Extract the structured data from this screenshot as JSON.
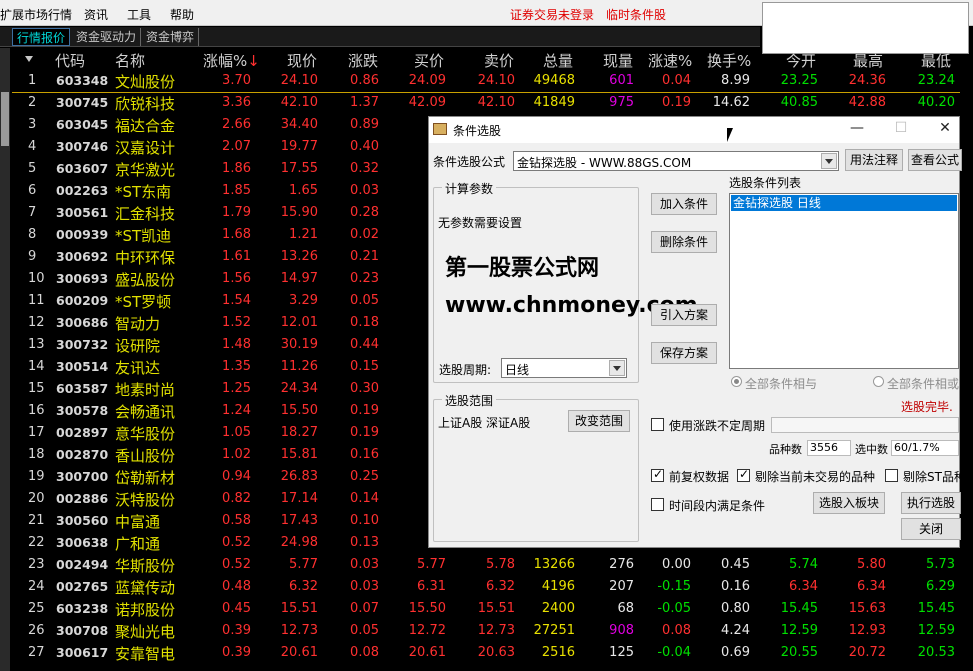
{
  "menu": {
    "items": [
      "扩展市场行情",
      "资讯",
      "工具",
      "帮助"
    ],
    "status_login": "证券交易未登录",
    "status_temp": "临时条件股"
  },
  "tabs": [
    "行情报价",
    "资金驱动力",
    "资金博弈"
  ],
  "table": {
    "headers": [
      "代码",
      "名称",
      "涨幅%",
      "现价",
      "涨跌",
      "买价",
      "卖价",
      "总量",
      "现量",
      "涨速%",
      "换手%",
      "今开",
      "最高",
      "最低"
    ],
    "rows": [
      [
        "1",
        "603348",
        "文灿股份",
        "3.70",
        "24.10",
        "0.86",
        "24.09",
        "24.10",
        "49468",
        "601",
        "0.04",
        "8.99",
        "23.25",
        "24.36",
        "23.24"
      ],
      [
        "2",
        "300745",
        "欣锐科技",
        "3.36",
        "42.10",
        "1.37",
        "42.09",
        "42.10",
        "41849",
        "975",
        "0.19",
        "14.62",
        "40.85",
        "42.88",
        "40.20"
      ],
      [
        "3",
        "603045",
        "福达合金",
        "2.66",
        "34.40",
        "0.89",
        "34",
        "",
        "",
        "",
        "",
        "",
        "",
        "",
        ""
      ],
      [
        "4",
        "300746",
        "汉嘉设计",
        "2.07",
        "19.77",
        "0.40",
        "19",
        "",
        "",
        "",
        "",
        "",
        "",
        "",
        ""
      ],
      [
        "5",
        "603607",
        "京华激光",
        "1.86",
        "17.55",
        "0.32",
        "17",
        "",
        "",
        "",
        "",
        "",
        "",
        "",
        ""
      ],
      [
        "6",
        "002263",
        "*ST东南",
        "1.85",
        "1.65",
        "0.03",
        "1",
        "",
        "",
        "",
        "",
        "",
        "",
        "",
        ""
      ],
      [
        "7",
        "300561",
        "汇金科技",
        "1.79",
        "15.90",
        "0.28",
        "15",
        "",
        "",
        "",
        "",
        "",
        "",
        "",
        ""
      ],
      [
        "8",
        "000939",
        "*ST凯迪",
        "1.68",
        "1.21",
        "0.02",
        "1",
        "",
        "",
        "",
        "",
        "",
        "",
        "",
        ""
      ],
      [
        "9",
        "300692",
        "中环环保",
        "1.61",
        "13.26",
        "0.21",
        "13",
        "",
        "",
        "",
        "",
        "",
        "",
        "",
        ""
      ],
      [
        "10",
        "300693",
        "盛弘股份",
        "1.56",
        "14.97",
        "0.23",
        "14",
        "",
        "",
        "",
        "",
        "",
        "",
        "",
        ""
      ],
      [
        "11",
        "600209",
        "*ST罗顿",
        "1.54",
        "3.29",
        "0.05",
        "3",
        "",
        "",
        "",
        "",
        "",
        "",
        "",
        ""
      ],
      [
        "12",
        "300686",
        "智动力",
        "1.52",
        "12.01",
        "0.18",
        "12",
        "",
        "",
        "",
        "",
        "",
        "",
        "",
        ""
      ],
      [
        "13",
        "300732",
        "设研院",
        "1.48",
        "30.19",
        "0.44",
        "30",
        "",
        "",
        "",
        "",
        "",
        "",
        "",
        ""
      ],
      [
        "14",
        "300514",
        "友讯达",
        "1.35",
        "11.26",
        "0.15",
        "11",
        "",
        "",
        "",
        "",
        "",
        "",
        "",
        ""
      ],
      [
        "15",
        "603587",
        "地素时尚",
        "1.25",
        "24.34",
        "0.30",
        "24",
        "",
        "",
        "",
        "",
        "",
        "",
        "",
        ""
      ],
      [
        "16",
        "300578",
        "会畅通讯",
        "1.24",
        "15.50",
        "0.19",
        "15",
        "",
        "",
        "",
        "",
        "",
        "",
        "",
        ""
      ],
      [
        "17",
        "002897",
        "意华股份",
        "1.05",
        "18.27",
        "0.19",
        "18",
        "",
        "",
        "",
        "",
        "",
        "",
        "",
        ""
      ],
      [
        "18",
        "002870",
        "香山股份",
        "1.02",
        "15.81",
        "0.16",
        "15",
        "",
        "",
        "",
        "",
        "",
        "",
        "",
        ""
      ],
      [
        "19",
        "300700",
        "岱勒新材",
        "0.94",
        "26.83",
        "0.25",
        "26",
        "",
        "",
        "",
        "",
        "",
        "",
        "",
        ""
      ],
      [
        "20",
        "002886",
        "沃特股份",
        "0.82",
        "17.14",
        "0.14",
        "17",
        "",
        "",
        "",
        "",
        "",
        "",
        "",
        ""
      ],
      [
        "21",
        "300560",
        "中富通",
        "0.58",
        "17.43",
        "0.10",
        "17",
        "",
        "",
        "",
        "",
        "",
        "",
        "",
        ""
      ],
      [
        "22",
        "300638",
        "广和通",
        "0.52",
        "24.98",
        "0.13",
        "24",
        "",
        "",
        "",
        "",
        "",
        "",
        "",
        ""
      ],
      [
        "23",
        "002494",
        "华斯股份",
        "0.52",
        "5.77",
        "0.03",
        "5.77",
        "5.78",
        "13266",
        "276",
        "0.00",
        "0.45",
        "5.74",
        "5.80",
        "5.73"
      ],
      [
        "24",
        "002765",
        "蓝黛传动",
        "0.48",
        "6.32",
        "0.03",
        "6.31",
        "6.32",
        "4196",
        "207",
        "-0.15",
        "0.16",
        "6.34",
        "6.34",
        "6.29"
      ],
      [
        "25",
        "603238",
        "诺邦股份",
        "0.45",
        "15.51",
        "0.07",
        "15.50",
        "15.51",
        "2400",
        "68",
        "-0.05",
        "0.80",
        "15.45",
        "15.63",
        "15.45"
      ],
      [
        "26",
        "300708",
        "聚灿光电",
        "0.39",
        "12.73",
        "0.05",
        "12.72",
        "12.73",
        "27251",
        "908",
        "0.08",
        "4.24",
        "12.59",
        "12.93",
        "12.59"
      ],
      [
        "27",
        "300617",
        "安靠智电",
        "0.39",
        "20.61",
        "0.08",
        "20.61",
        "20.63",
        "2516",
        "125",
        "-0.04",
        "0.69",
        "20.55",
        "20.72",
        "20.53"
      ]
    ]
  },
  "dialog": {
    "title": "条件选股",
    "formula_label": "条件选股公式",
    "formula_value": "金钻探选股   - WWW.88GS.COM",
    "usage_btn": "用法注释",
    "view_btn": "查看公式",
    "calc_group": "计算参数",
    "no_params": "无参数需要设置",
    "watermark_name": "第一股票公式网",
    "watermark_url": "www.chnmoney.com",
    "add_btn": "加入条件",
    "delete_btn": "删除条件",
    "import_btn": "引入方案",
    "save_btn": "保存方案",
    "list_label": "选股条件列表",
    "list_item": "金钻探选股   日线",
    "period_label": "选股周期:",
    "period_value": "日线",
    "all_and": "全部条件相与",
    "all_or": "全部条件相或",
    "done": "选股完毕.",
    "range_group": "选股范围",
    "range_value": "上证A股  深证A股",
    "change_range_btn": "改变范围",
    "use_uncertain": "使用涨跌不定周期",
    "count_label": "品种数",
    "count_value": "3556",
    "selected_label": "选中数",
    "selected_value": "60/1.7%",
    "adj_label": "前复权数据",
    "exclude_label": "剔除当前未交易的品种",
    "exclude_st": "剔除ST品种",
    "time_label": "时间段内满足条件",
    "to_block_btn": "选股入板块",
    "exec_btn": "执行选股",
    "close_btn": "关闭"
  },
  "colors": {
    "up": "#ff3030",
    "down": "#00e000",
    "name": "#e8e000",
    "volume_big": "#e000e0"
  }
}
